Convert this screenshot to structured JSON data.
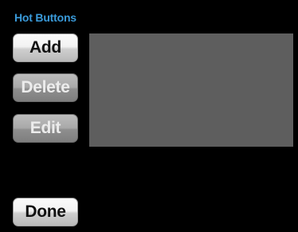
{
  "title": "Hot Buttons",
  "buttons": {
    "add": "Add",
    "delete": "Delete",
    "edit": "Edit",
    "done": "Done"
  },
  "colors": {
    "title": "#3a9ad9",
    "background": "#000000",
    "list_area": "#5e5e5e"
  },
  "states": {
    "add_enabled": true,
    "delete_enabled": false,
    "edit_enabled": false,
    "done_enabled": true
  },
  "list": {
    "items": []
  }
}
